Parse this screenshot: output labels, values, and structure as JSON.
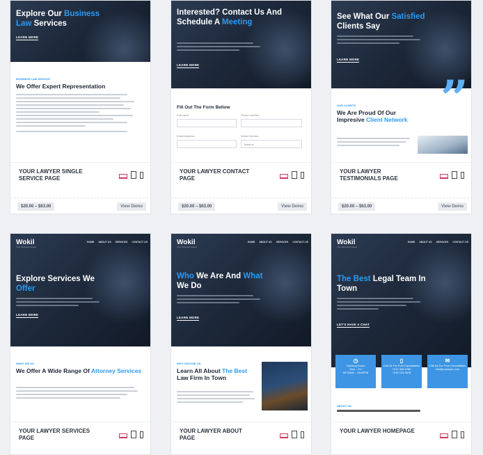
{
  "cards": [
    {
      "hero_title_pre": "Explore Our ",
      "hero_title_hl": "Business",
      "hero_title_hl2": "Law",
      "hero_title_post": " Services",
      "learn": "LEARN MORE",
      "tag": "BUSINESS LAW SERVICE",
      "section_title": "We Offer Expert Representation",
      "title": "YOUR LAWYER SINGLE SERVICE PAGE",
      "price": "$20.00 – $63.00",
      "demo": "View Demo"
    },
    {
      "hero_title_pre": "Interested? Contact Us And Schedule A ",
      "hero_title_hl": "Meeting",
      "learn": "LEARN MORE",
      "form_title": "Fill Out The Form Bellow",
      "label_fullname": "Full name",
      "label_phone": "Phone number",
      "label_email": "Email Address",
      "label_service": "Select Service",
      "select_value": "Select",
      "title": "YOUR LAWYER CONTACT PAGE",
      "price": "$20.00 – $63.00",
      "demo": "View Demo"
    },
    {
      "hero_title_pre": "See What Our ",
      "hero_title_hl": "Satisfied",
      "hero_title_post": " Clients Say",
      "learn": "LEARN MORE",
      "tag": "OUR CLIENTS",
      "section_title_pre": "We Are Proud Of Our Impresive ",
      "section_title_hl": "Client Network",
      "title": "YOUR LAWYER TESTIMONIALS PAGE",
      "price": "$20.00 – $63.00",
      "demo": "View Demo"
    },
    {
      "logo": "Wokil",
      "logo_sub": "Your Personal Lawyer",
      "nav": [
        "HOME",
        "ABOUT US",
        "SERVICES",
        "CONTACT US"
      ],
      "hero_title_pre": "Explore Services We ",
      "hero_title_hl": "Offer",
      "learn": "LEARN MORE",
      "tag": "WHAT WE DO",
      "section_title_pre": "We Offer A Wide Range Of ",
      "section_title_hl": "Attorney Services",
      "title": "YOUR LAWYER SERVICES PAGE"
    },
    {
      "logo": "Wokil",
      "logo_sub": "Your Personal Lawyer",
      "nav": [
        "HOME",
        "ABOUT US",
        "SERVICES",
        "CONTACT US"
      ],
      "hero_title_hl": "Who",
      "hero_title_mid": " We Are And ",
      "hero_title_hl2": "What",
      "hero_title_post": " We Do",
      "learn": "LEARN MORE",
      "tag": "WHY CHOOSE US",
      "section_title_pre": "Learn All About ",
      "section_title_hl": "The Best",
      "section_title_post": " Law Firm In Town",
      "title": "YOUR LAWYER ABOUT PAGE"
    },
    {
      "logo": "Wokil",
      "logo_sub": "Your Personal Lawyer",
      "nav": [
        "HOME",
        "ABOUT US",
        "SERVICES",
        "CONTACT US"
      ],
      "hero_title_hl": "The Best",
      "hero_title_post": " Legal Team In Town",
      "learn": "LET'S HAVE A CHAT",
      "boxes": [
        {
          "title": "Opening Hours",
          "line1": "Mon – Fri",
          "line2": "09:00AM – 05:00PM"
        },
        {
          "title": "Call Us For Free Consultation",
          "line1": "+012 345 6789",
          "line2": "+076 134 5678"
        },
        {
          "title": "Call Us For Free Consultation",
          "line1": "info@example.com",
          "line2": ""
        }
      ],
      "tag": "ABOUT US",
      "title": "YOUR LAWYER HOMEPAGE"
    }
  ],
  "colors": {
    "accent": "#2b9af3",
    "hero": "#1b2637",
    "desktop_icon": "#d1355e"
  },
  "icons": [
    "desktop-icon",
    "tablet-icon",
    "phone-icon"
  ]
}
